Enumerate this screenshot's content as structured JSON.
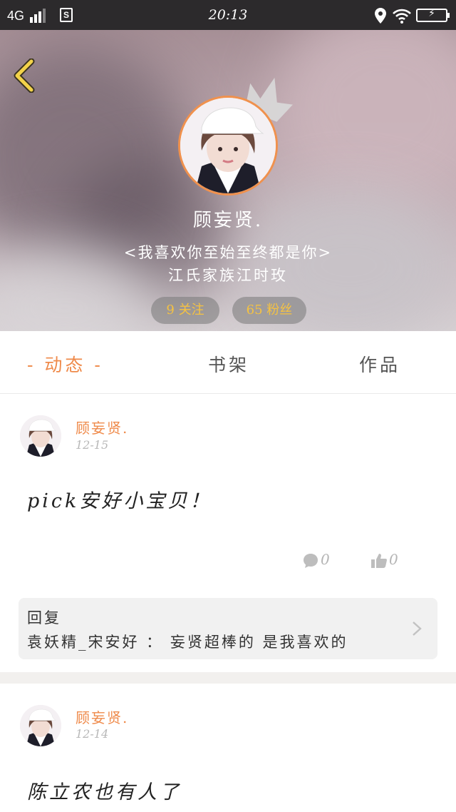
{
  "status_bar": {
    "network": "4G",
    "sim_badge": "S",
    "time": "20:13"
  },
  "profile": {
    "username": "顾妄贤.",
    "bio_line1": "<我喜欢你至始至终都是你>",
    "bio_line2": "江氏家族江时玫",
    "following": "9 关注",
    "followers": "65 粉丝"
  },
  "tabs": [
    {
      "label": "- 动态 -"
    },
    {
      "label": "书架"
    },
    {
      "label": "作品"
    }
  ],
  "posts": [
    {
      "author": "顾妄贤.",
      "date": "12-15",
      "text": "pick安好小宝贝！",
      "comments": "0",
      "likes": "0",
      "reply_title": "回复",
      "reply_text": "袁妖精_宋安好 ： 妄贤超棒的 是我喜欢的"
    },
    {
      "author": "顾妄贤.",
      "date": "12-14",
      "text": "陈立农也有人了"
    }
  ],
  "colors": {
    "accent": "#ef8a4a",
    "pill_text": "#f5c242",
    "back_arrow": "#f3d34a"
  }
}
